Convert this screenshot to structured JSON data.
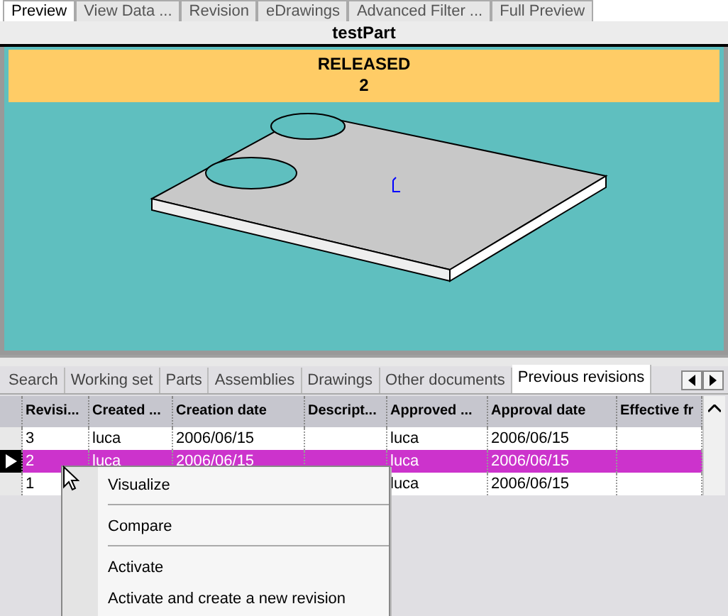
{
  "top_tabs": [
    {
      "label": "Preview",
      "selected": true
    },
    {
      "label": "View Data ...",
      "selected": false
    },
    {
      "label": "Revision",
      "selected": false
    },
    {
      "label": "eDrawings",
      "selected": false
    },
    {
      "label": "Advanced Filter ...",
      "selected": false
    },
    {
      "label": "Full Preview",
      "selected": false
    }
  ],
  "title": "testPart",
  "banner": {
    "state": "RELEASED",
    "revision": "2"
  },
  "bottom_tabs": [
    {
      "label": "Search",
      "selected": false
    },
    {
      "label": "Working set",
      "selected": false
    },
    {
      "label": "Parts",
      "selected": false
    },
    {
      "label": "Assemblies",
      "selected": false
    },
    {
      "label": "Drawings",
      "selected": false
    },
    {
      "label": "Other documents",
      "selected": false
    },
    {
      "label": "Previous revisions",
      "selected": true
    }
  ],
  "table": {
    "columns": [
      "Revisi...",
      "Created ...",
      "Creation date",
      "Descript...",
      "Approved ...",
      "Approval date",
      "Effective fr"
    ],
    "rows": [
      {
        "cells": [
          "3",
          "luca",
          "2006/06/15",
          "",
          "luca",
          "2006/06/15",
          ""
        ],
        "selected": false
      },
      {
        "cells": [
          "2",
          "luca",
          "2006/06/15",
          "",
          "luca",
          "2006/06/15",
          ""
        ],
        "selected": true
      },
      {
        "cells": [
          "1",
          "",
          "",
          "",
          "luca",
          "2006/06/15",
          ""
        ],
        "selected": false
      }
    ]
  },
  "context_menu": [
    {
      "kind": "item",
      "label": "Visualize"
    },
    {
      "kind": "separator"
    },
    {
      "kind": "item",
      "label": "Compare"
    },
    {
      "kind": "separator"
    },
    {
      "kind": "item",
      "label": "Activate"
    },
    {
      "kind": "item",
      "label": "Activate and create a new revision"
    }
  ]
}
